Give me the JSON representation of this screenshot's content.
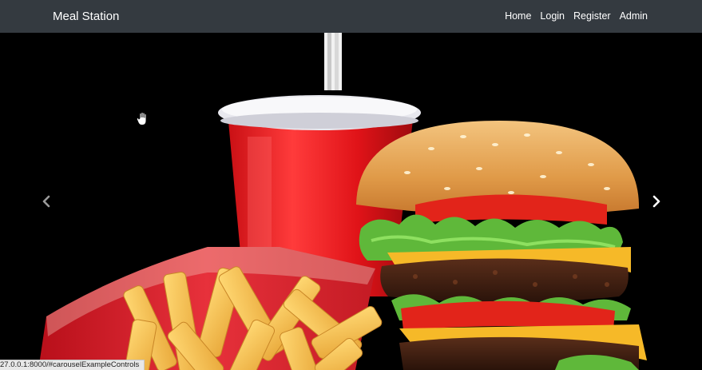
{
  "navbar": {
    "brand": "Meal Station",
    "links": [
      {
        "label": "Home"
      },
      {
        "label": "Login"
      },
      {
        "label": "Register"
      },
      {
        "label": "Admin"
      }
    ],
    "background": "#343a40"
  },
  "carousel": {
    "prev_icon": "chevron-left-icon",
    "next_icon": "chevron-right-icon"
  },
  "status_bar": {
    "url": "27.0.0.1:8000/#carouselExampleControls"
  }
}
